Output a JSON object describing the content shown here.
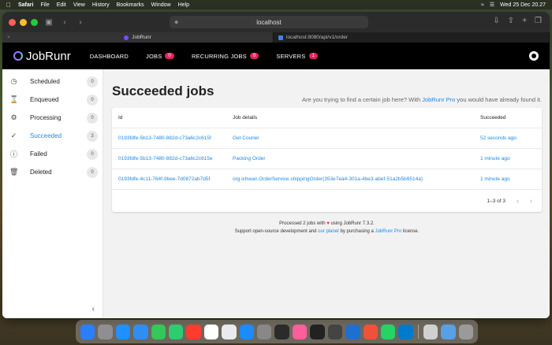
{
  "menubar": {
    "app": "Safari",
    "items": [
      "File",
      "Edit",
      "View",
      "History",
      "Bookmarks",
      "Window",
      "Help"
    ],
    "clock": "Wed 25 Dec  20.27"
  },
  "browser": {
    "url": "localhost",
    "tabs": [
      {
        "label": "JobRunr"
      },
      {
        "label": "localhost:8080/api/v1/order"
      }
    ]
  },
  "app": {
    "logo": "JobRunr",
    "nav": [
      {
        "label": "DASHBOARD"
      },
      {
        "label": "JOBS",
        "badge": "0"
      },
      {
        "label": "RECURRING JOBS",
        "badge": "0"
      },
      {
        "label": "SERVERS",
        "badge": "1"
      }
    ]
  },
  "sidebar": {
    "items": [
      {
        "label": "Scheduled",
        "count": "0",
        "icon": "clock-icon"
      },
      {
        "label": "Enqueued",
        "count": "0",
        "icon": "hourglass-icon"
      },
      {
        "label": "Processing",
        "count": "0",
        "icon": "gears-icon"
      },
      {
        "label": "Succeeded",
        "count": "3",
        "icon": "check-icon"
      },
      {
        "label": "Failed",
        "count": "0",
        "icon": "alert-icon"
      },
      {
        "label": "Deleted",
        "count": "0",
        "icon": "trash-icon"
      }
    ]
  },
  "main": {
    "title": "Succeeded jobs",
    "promo_prefix": "Are you trying to find a certain job here? With",
    "promo_link": "JobRunr Pro",
    "promo_suffix": "you would have already found it.",
    "headers": {
      "id": "Id",
      "details": "Job details",
      "status": "Succeeded"
    },
    "rows": [
      {
        "id": "0193fdfe-5b13-7480-882d-c73a6c2c615f",
        "details": "Get Courier",
        "time": "52 seconds ago"
      },
      {
        "id": "0193fdfe-5b13-7480-882d-c73a6c2c615e",
        "details": "Packing Order",
        "time": "1 minute ago"
      },
      {
        "id": "0193fdfe-4c11-764f-9bee-7d0872ab7d5f",
        "details": "org.ichwan.OrderService.shippingOrder(353e7ea4-301a-4be3-abef-51a2b5b9514a)",
        "time": "1 minute ago"
      }
    ],
    "pager": "1–3 of 3"
  },
  "footer": {
    "line1_a": "Processed 2 jobs with",
    "line1_b": "using JobRunr 7.3.2.",
    "line2_a": "Support open-source development and",
    "line2_link1": "our planet",
    "line2_b": "by purchasing a",
    "line2_link2": "JobRunr Pro",
    "line2_c": "license."
  },
  "dock": {
    "colors": [
      "#2a7fff",
      "#8e8e93",
      "#1e90ff",
      "#2f8ef4",
      "#34c759",
      "#2ecc71",
      "#ff3b30",
      "#ffffff",
      "#e9e9ee",
      "#1a8cff",
      "#888888",
      "#2b2b2b",
      "#ff5e9c",
      "#222222",
      "#444444",
      "#1f6fd1",
      "#f05138",
      "#25d366",
      "#007acc",
      "#d0d0d0",
      "#57a0e6",
      "#9a9a9a"
    ]
  }
}
